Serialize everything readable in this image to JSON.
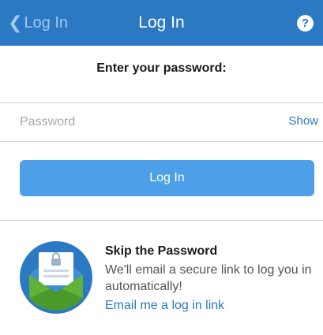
{
  "navbar": {
    "back_label": "Log In",
    "title": "Log In",
    "help_glyph": "?",
    "back_icon": "chevron-left-icon",
    "help_icon": "question-circle-icon"
  },
  "form": {
    "prompt": "Enter your password:",
    "password_placeholder": "Password",
    "password_value": "",
    "show_label": "Show",
    "login_button": "Log In"
  },
  "skip": {
    "icon": "envelope-lock-icon",
    "title": "Skip the Password",
    "description": "We'll email a secure link to log you in automatically!",
    "link": "Email me a log in link"
  },
  "colors": {
    "navbar": "#2a79c2",
    "button": "#4da0e8",
    "link": "#2a79c2",
    "envelope_green": "#5fb23a"
  }
}
